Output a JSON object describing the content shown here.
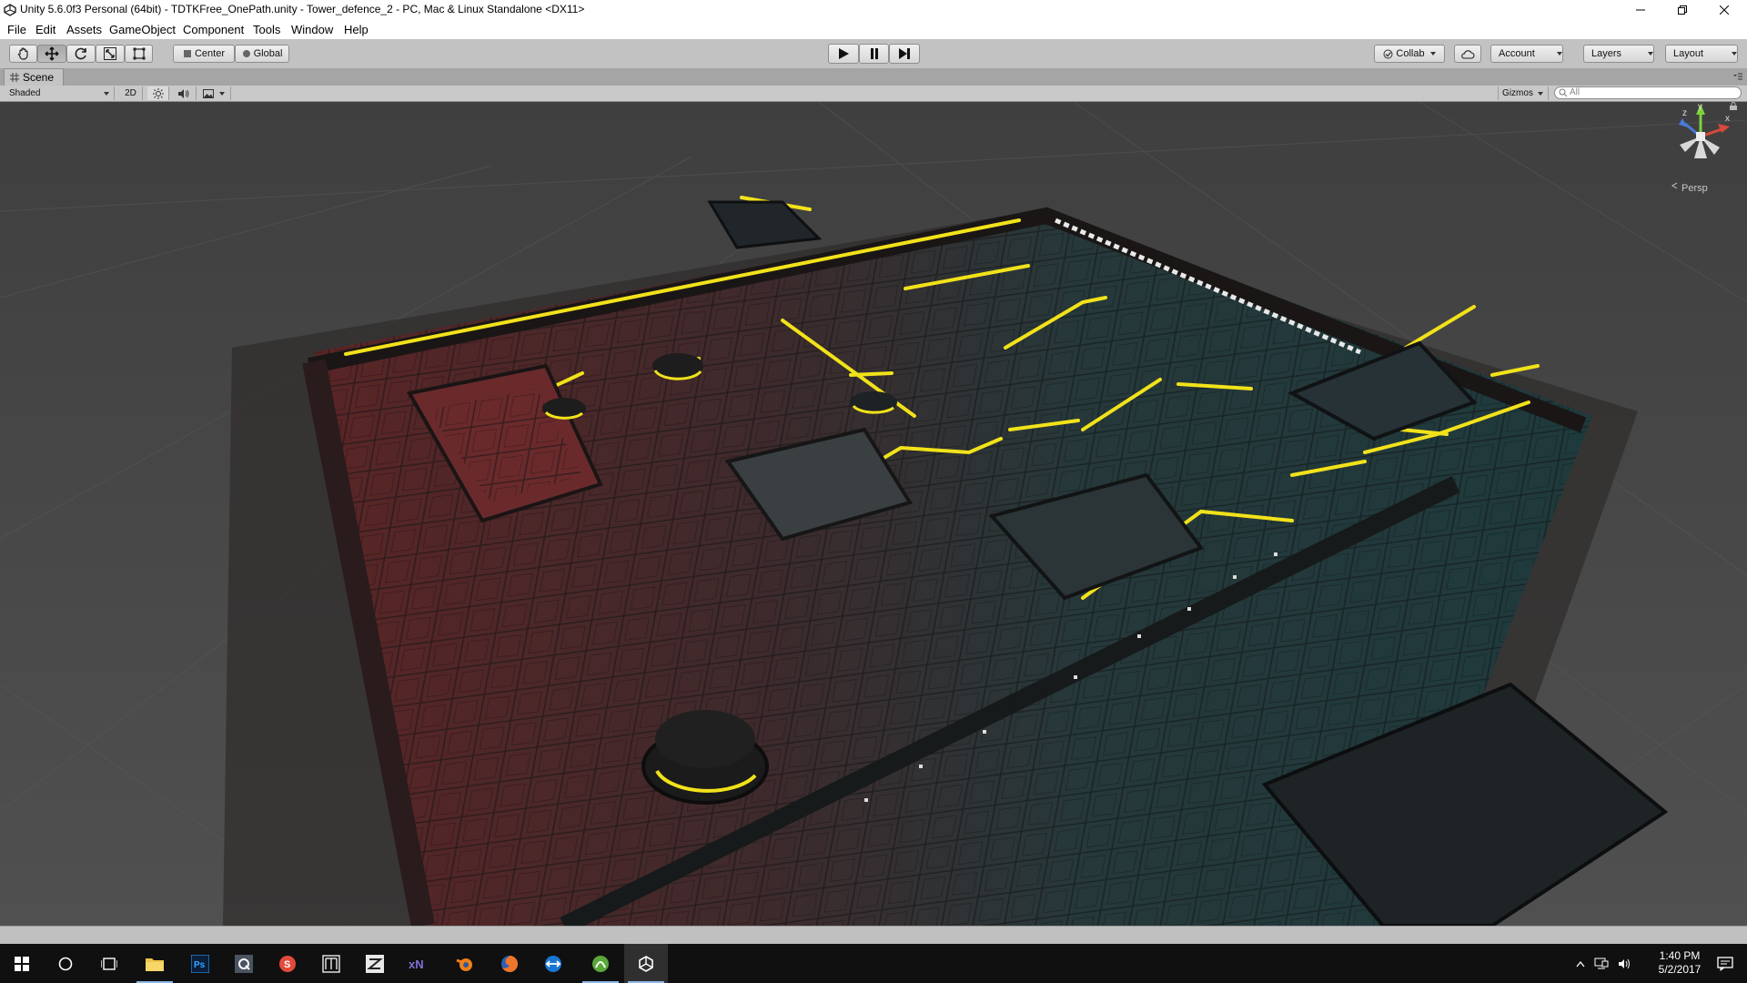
{
  "window": {
    "title": "Unity 5.6.0f3 Personal (64bit) - TDTKFree_OnePath.unity - Tower_defence_2 - PC, Mac & Linux Standalone <DX11>",
    "controls": [
      "minimize-icon",
      "restore-icon",
      "close-icon"
    ]
  },
  "menu": [
    "File",
    "Edit",
    "Assets",
    "GameObject",
    "Component",
    "Tools",
    "Window",
    "Help"
  ],
  "toolbar": {
    "tools": [
      "hand-icon",
      "move-icon",
      "rotate-icon",
      "scale-icon",
      "rect-transform-icon"
    ],
    "active_tool": "move-icon",
    "pivot_label": "Center",
    "space_label": "Global",
    "playback": [
      "play-icon",
      "pause-icon",
      "step-icon"
    ],
    "collab_label": "Collab",
    "account_label": "Account",
    "layers_label": "Layers",
    "layout_label": "Layout"
  },
  "scene_tab": {
    "label": "Scene"
  },
  "scene_toolbar": {
    "draw_mode": "Shaded",
    "mode_2d": "2D",
    "gizmos_label": "Gizmos",
    "search_placeholder": "All"
  },
  "gizmo": {
    "axis_x": "x",
    "axis_y": "y",
    "axis_z": "z",
    "projection_label": "Persp"
  },
  "taskbar": {
    "apps": [
      "windows-start-icon",
      "cortana-search-icon",
      "task-view-icon",
      "file-explorer-icon",
      "photoshop-icon",
      "quixel-icon",
      "substance-painter-icon",
      "marmoset-icon",
      "zbrush-icon",
      "xnormal-icon",
      "blender-icon",
      "firefox-icon",
      "teamviewer-icon",
      "green-app-icon",
      "unity-icon"
    ],
    "time": "1:40 PM",
    "date": "5/2/2017"
  },
  "colors": {
    "accent_yellow": "#f2e21a",
    "floor_red": "#6b2a2a",
    "floor_teal": "#2a4f4f",
    "ground": "#4a4a4a",
    "taskbar": "#101010"
  }
}
